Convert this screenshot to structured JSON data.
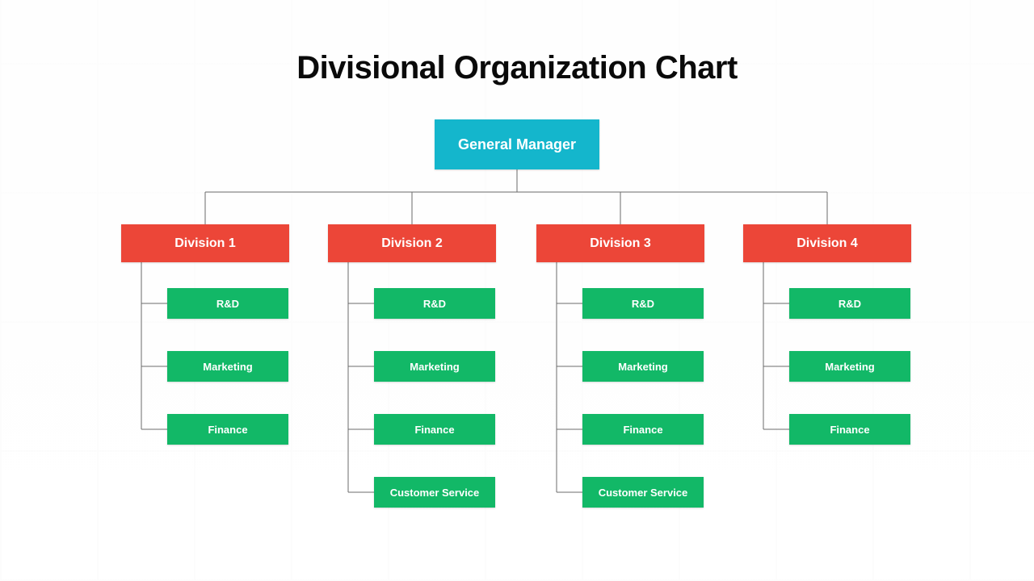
{
  "title": "Divisional Organization Chart",
  "colors": {
    "top": "#14b6cc",
    "division": "#ec4638",
    "department": "#12b867",
    "connector": "#6b6b6b"
  },
  "org": {
    "root": {
      "label": "General Manager"
    },
    "divisions": [
      {
        "label": "Division 1",
        "departments": [
          "R&D",
          "Marketing",
          "Finance"
        ]
      },
      {
        "label": "Division 2",
        "departments": [
          "R&D",
          "Marketing",
          "Finance",
          "Customer Service"
        ]
      },
      {
        "label": "Division 3",
        "departments": [
          "R&D",
          "Marketing",
          "Finance",
          "Customer Service"
        ]
      },
      {
        "label": "Division 4",
        "departments": [
          "R&D",
          "Marketing",
          "Finance"
        ]
      }
    ]
  }
}
